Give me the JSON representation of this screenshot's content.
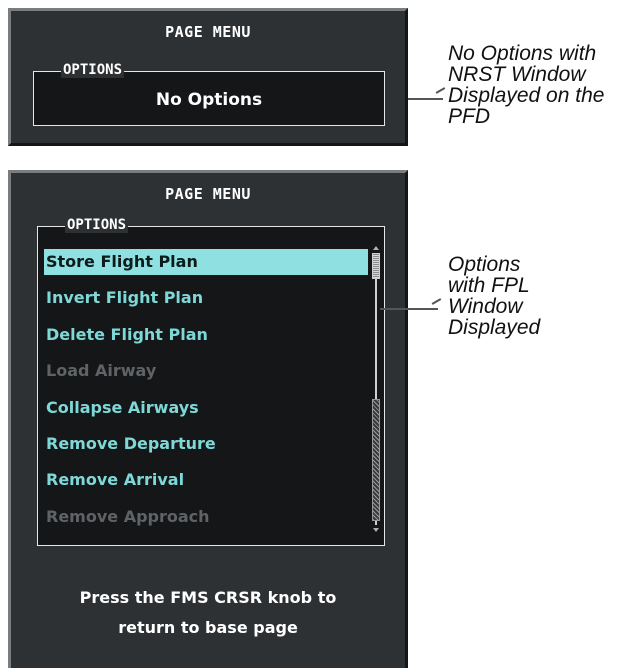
{
  "panel_top": {
    "title": "PAGE MENU",
    "options_label": "OPTIONS",
    "no_options_text": "No Options"
  },
  "panel_bottom": {
    "title": "PAGE MENU",
    "options_label": "OPTIONS",
    "items": [
      {
        "label": "Store Flight Plan",
        "state": "selected"
      },
      {
        "label": "Invert Flight Plan",
        "state": "enabled"
      },
      {
        "label": "Delete Flight Plan",
        "state": "enabled"
      },
      {
        "label": "Load Airway",
        "state": "disabled"
      },
      {
        "label": "Collapse Airways",
        "state": "enabled"
      },
      {
        "label": "Remove Departure",
        "state": "enabled"
      },
      {
        "label": "Remove Arrival",
        "state": "enabled"
      },
      {
        "label": "Remove Approach",
        "state": "disabled"
      }
    ],
    "footer_line1": "Press the FMS CRSR knob to",
    "footer_line2": "return to base page"
  },
  "callouts": {
    "top_line1": "No Options with",
    "top_line2": "NRST Window",
    "top_line3": "Displayed on the",
    "top_line4": "PFD",
    "bottom_line1": "Options",
    "bottom_line2": "with FPL",
    "bottom_line3": "Window",
    "bottom_line4": "Displayed"
  },
  "colors": {
    "panel_bg": "#2e3133",
    "list_bg": "#151617",
    "item_cyan": "#7fd8d8",
    "selected_bg": "#8fe0e0",
    "disabled": "#5f6366"
  }
}
